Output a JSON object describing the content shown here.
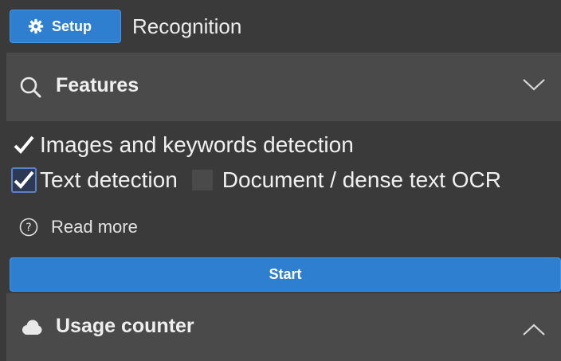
{
  "header": {
    "setup_label": "Setup",
    "title": "Recognition"
  },
  "features": {
    "label": "Features",
    "expanded": false,
    "options": [
      {
        "label": "Images and keywords detection",
        "checked": true
      },
      {
        "label": "Text detection",
        "checked": true,
        "focused": true
      },
      {
        "label": "Document / dense text OCR",
        "checked": false
      }
    ],
    "read_more": "Read more"
  },
  "start_label": "Start",
  "usage": {
    "label": "Usage counter",
    "expanded": true
  },
  "colors": {
    "accent": "#2f7fd1",
    "background": "#3a3a3a",
    "section_bar": "#4a4a4a"
  },
  "icons": {
    "setup": "gear-icon",
    "features": "search-icon",
    "features_toggle": "chevron-down-icon",
    "read_more": "help-circle-icon",
    "usage": "cloud-icon",
    "usage_toggle": "chevron-up-icon"
  }
}
